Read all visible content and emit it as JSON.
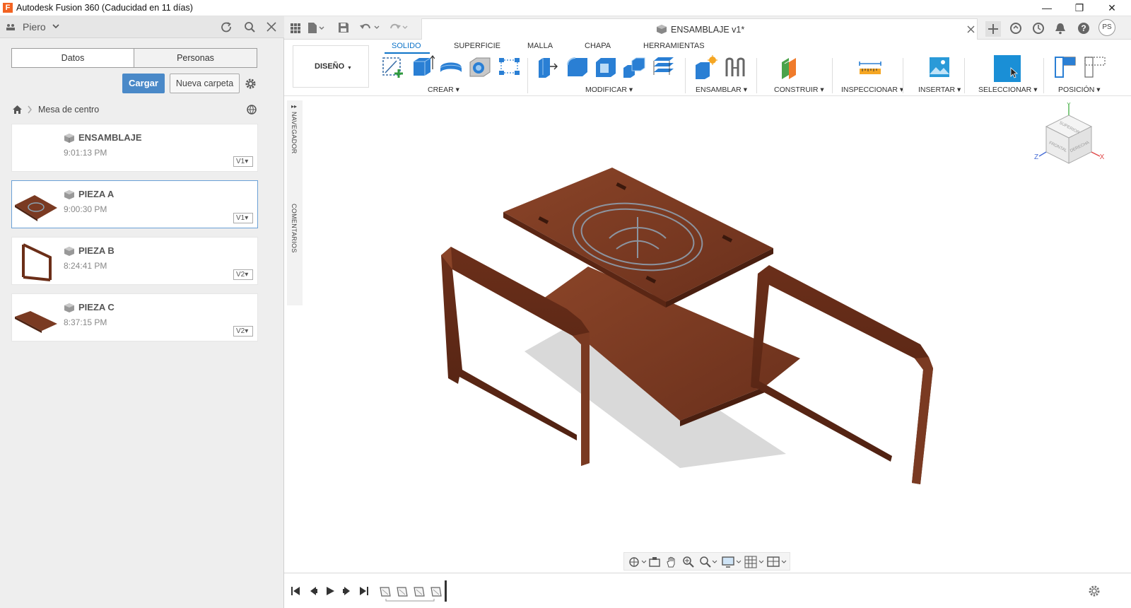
{
  "window": {
    "title": "Autodesk Fusion 360 (Caducidad en 11 días)",
    "app_icon_letter": "F",
    "minimize": "—",
    "restore": "❐",
    "close": "✕"
  },
  "left_panel": {
    "user": "Piero",
    "tabs": [
      "Datos",
      "Personas"
    ],
    "upload_button": "Cargar",
    "new_folder_button": "Nueva carpeta",
    "breadcrumb": "Mesa de centro",
    "files": [
      {
        "name": "ENSAMBLAJE",
        "time": "9:01:13 PM",
        "version": "V1"
      },
      {
        "name": "PIEZA A",
        "time": "9:00:30 PM",
        "version": "V1"
      },
      {
        "name": "PIEZA B",
        "time": "8:24:41 PM",
        "version": "V2"
      },
      {
        "name": "PIEZA C",
        "time": "8:37:15 PM",
        "version": "V2"
      }
    ]
  },
  "document": {
    "tab_title": "ENSAMBLAJE v1*"
  },
  "toolbar": {
    "workspace": "DISEÑO",
    "ribbon_tabs": [
      "SOLIDO",
      "SUPERFICIE",
      "MALLA",
      "CHAPA",
      "HERRAMIENTAS"
    ],
    "groups": [
      "CREAR",
      "MODIFICAR",
      "ENSAMBLAR",
      "CONSTRUIR",
      "INSPECCIONAR",
      "INSERTAR",
      "SELECCIONAR",
      "POSICIÓN"
    ]
  },
  "side_tabs": {
    "navigator": "NAVEGADOR",
    "comments": "COMENTARIOS"
  },
  "viewcube": {
    "top": "SUPERIOR",
    "front": "FRONTAL",
    "right": "DERECHA",
    "axis_x": "X",
    "axis_y": "Y",
    "axis_z": "Z"
  },
  "user_initials": "PS",
  "colors": {
    "accent": "#0d73c8",
    "wood": "#7a3a22",
    "select_blue": "#1a8fd6",
    "primary_button": "#4a89c8"
  }
}
